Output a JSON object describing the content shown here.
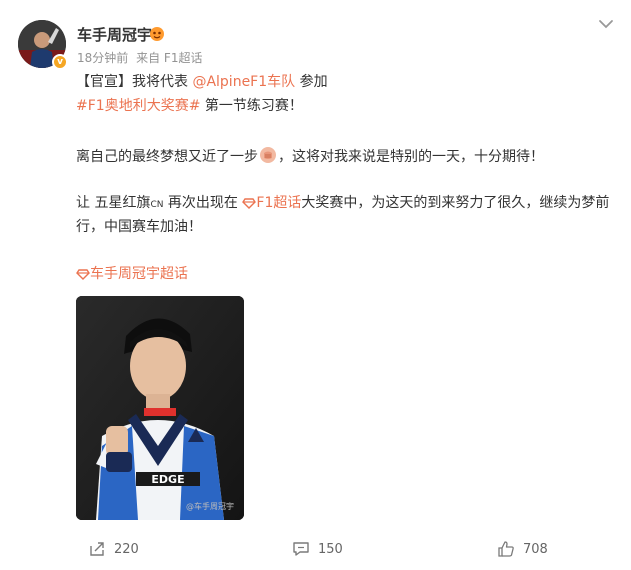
{
  "user": {
    "name": "车手周冠宇",
    "verify_mark": "v",
    "time": "18分钟前",
    "source": "来自 F1超话"
  },
  "post": {
    "line1_prefix": "【官宣】我将代表 ",
    "line1_mention": "@AlpineF1车队",
    "line1_suffix": " 参加",
    "line2_topic": "#F1奥地利大奖赛#",
    "line2_suffix": " 第一节练习赛！",
    "line3_text": "离自己的最终梦想又近了一步",
    "line3_suffix": "，这将对我来说是特别的一天，十分期待！",
    "line4_prefix": "让 五星红旗",
    "line4_flag": "CN",
    "line4_mid": " 再次出现在 ",
    "line4_supertopic": "F1超话",
    "line4_suffix": "大奖赛中，为这天的到来努力了很久，继续为梦前",
    "line5_text": "行，中国赛车加油！",
    "supertopic_link": "车手周冠宇超话"
  },
  "photo": {
    "watermark": "@车手周冠宇",
    "logo_text": "EDGE"
  },
  "actions": {
    "repost_count": "220",
    "comment_count": "150",
    "like_count": "708"
  },
  "colors": {
    "accent": "#eb7350",
    "text": "#333333",
    "meta": "#939393"
  }
}
